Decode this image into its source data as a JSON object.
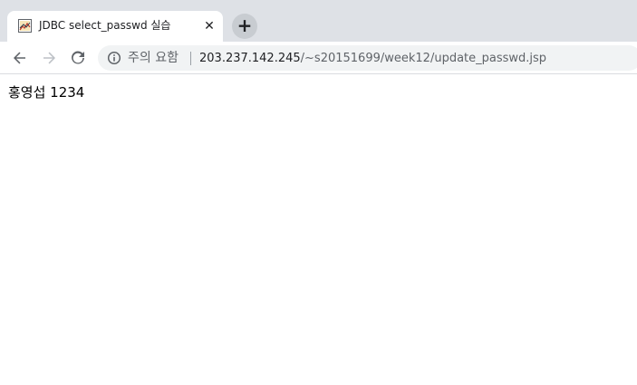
{
  "tab": {
    "title": "JDBC select_passwd 실습",
    "favicon": "jsp-document-icon",
    "close_glyph": "✕"
  },
  "new_tab_glyph": "+",
  "toolbar": {
    "back_icon": "arrow-left-icon",
    "forward_icon": "arrow-right-icon",
    "reload_icon": "reload-icon"
  },
  "omnibox": {
    "security_icon": "info-icon",
    "security_label": "주의 요함",
    "url_host": "203.237.142.245",
    "url_path": "/~s20151699/week12/update_passwd.jsp"
  },
  "page": {
    "output_text": "홍영섭 1234"
  },
  "colors": {
    "tab_strip_bg": "#dee1e6",
    "omnibox_bg": "#f1f3f4",
    "text_primary": "#202124",
    "text_secondary": "#5f6368"
  }
}
